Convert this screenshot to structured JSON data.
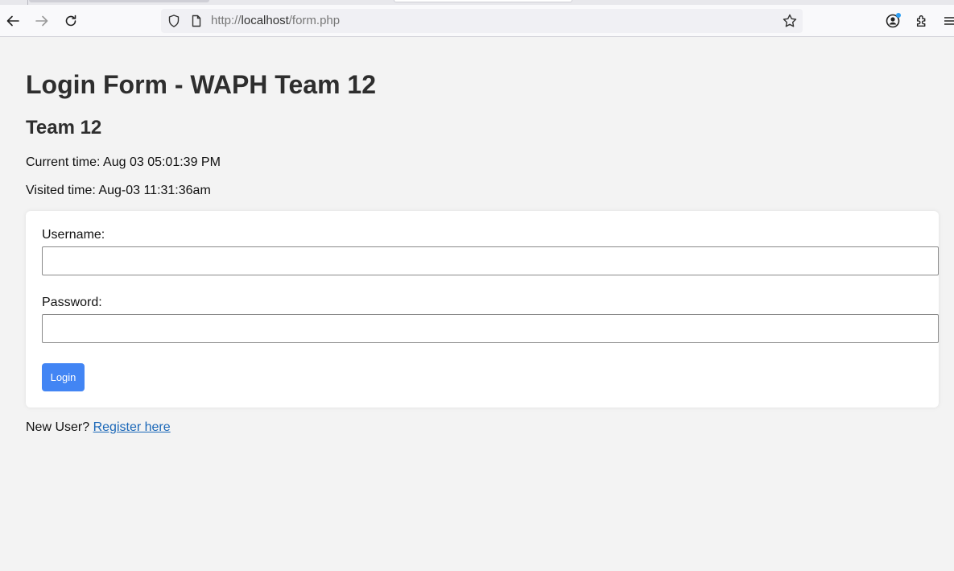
{
  "browser": {
    "url_prefix": "http://",
    "url_host": "localhost",
    "url_path": "/form.php"
  },
  "page": {
    "title": "Login Form - WAPH Team 12",
    "subtitle": "Team 12",
    "current_time": "Current time: Aug 03 05:01:39 PM",
    "visited_time": "Visited time: Aug-03 11:31:36am"
  },
  "form": {
    "username_label": "Username:",
    "username_value": "",
    "password_label": "Password:",
    "password_value": "",
    "login_label": "Login"
  },
  "footer": {
    "new_user_text": "New User?",
    "register_link": "Register here"
  },
  "colors": {
    "page_background": "#f3f3f3",
    "login_button": "#4285f4",
    "link": "#1a67b8"
  },
  "icons": [
    "back-icon",
    "forward-icon",
    "reload-icon",
    "shield-icon",
    "page-icon",
    "bookmark-star-icon",
    "account-icon",
    "extensions-icon",
    "menu-icon"
  ]
}
